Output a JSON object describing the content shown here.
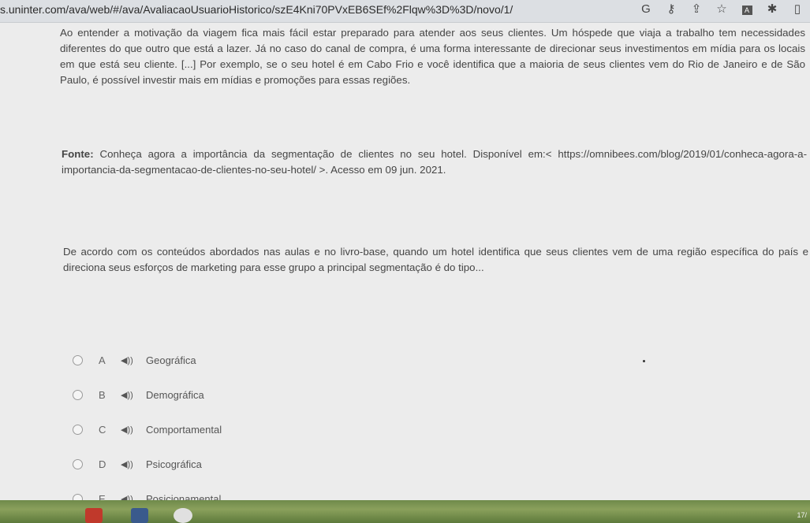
{
  "browser": {
    "url": "s.uninter.com/ava/web/#/ava/AvaliacaoUsuarioHistorico/szE4Kni70PVxEB6SEf%2Flqw%3D%3D/novo/1/",
    "icons": [
      "google-icon",
      "key-icon",
      "share-icon",
      "star-icon",
      "extension-icon",
      "puzzle-icon",
      "window-icon"
    ]
  },
  "question": {
    "paragraph1": "Ao entender a motivação da viagem fica mais fácil estar preparado para atender aos seus clientes. Um hóspede que viaja a trabalho tem necessidades diferentes do que outro que está a lazer. Já no caso do canal de compra, é uma forma interessante de direcionar seus investimentos em mídia para os locais em que está seu cliente. [...] Por exemplo, se o seu hotel é em Cabo Frio e você identifica que a maioria de seus clientes vem do Rio de Janeiro e de São Paulo, é possível investir mais em mídias e promoções para essas regiões.",
    "source_label": "Fonte:",
    "source_text": "Conheça agora a importância da segmentação de clientes no seu hotel. Disponível em:< https://omnibees.com/blog/2019/01/conheca-agora-a-importancia-da-segmentacao-de-clientes-no-seu-hotel/ >. Acesso em 09 jun. 2021.",
    "prompt": "De acordo com os conteúdos abordados nas aulas e no livro-base, quando um hotel identifica que seus clientes vem de uma região específica do país e direciona seus esforços de marketing para esse grupo a principal segmentação é do tipo..."
  },
  "options": [
    {
      "letter": "A",
      "label": "Geográfica"
    },
    {
      "letter": "B",
      "label": "Demográfica"
    },
    {
      "letter": "C",
      "label": "Comportamental"
    },
    {
      "letter": "D",
      "label": "Psicográfica"
    },
    {
      "letter": "E",
      "label": "Posicionamental"
    }
  ],
  "taskbar": {
    "clock": "17/"
  }
}
